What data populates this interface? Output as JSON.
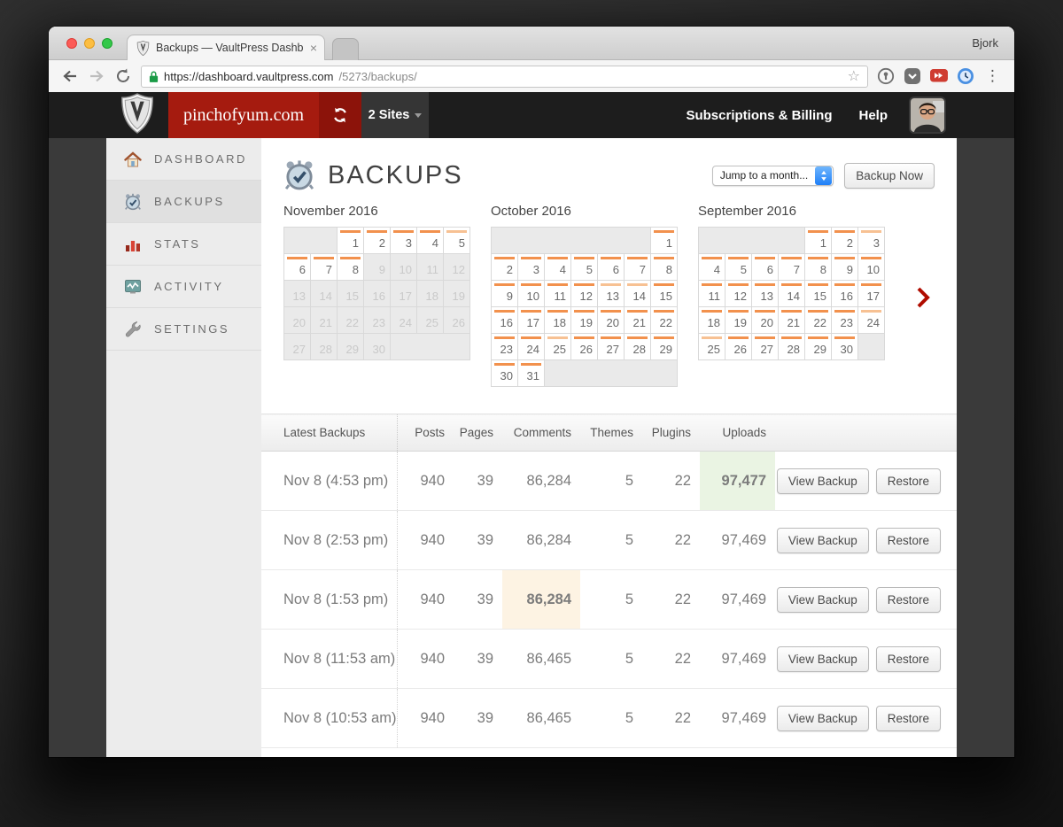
{
  "browser": {
    "profile_name": "Bjork",
    "tab_title": "Backups — VaultPress Dashbo",
    "tab_close": "×",
    "url_host": "https://dashboard.vaultpress.com",
    "url_path": "/5273/backups/"
  },
  "topbar": {
    "site_name": "pinchofyum.com",
    "sites_label": "2 Sites",
    "links": {
      "billing": "Subscriptions & Billing",
      "help": "Help"
    }
  },
  "sidebar": {
    "items": [
      {
        "label": "DASHBOARD",
        "icon": "house-icon",
        "selected": false
      },
      {
        "label": "BACKUPS",
        "icon": "alarm-clock-icon",
        "selected": true
      },
      {
        "label": "STATS",
        "icon": "bar-chart-icon",
        "selected": false
      },
      {
        "label": "ACTIVITY",
        "icon": "activity-monitor-icon",
        "selected": false
      },
      {
        "label": "SETTINGS",
        "icon": "wrench-icon",
        "selected": false
      }
    ]
  },
  "main": {
    "title": "BACKUPS",
    "month_select_value": "Jump to a month...",
    "backup_now_label": "Backup Now",
    "calendars": [
      {
        "title": "November 2016",
        "weeks": [
          [
            {
              "span": 2
            },
            {
              "d": "1",
              "bar": "full"
            },
            {
              "d": "2",
              "bar": "full"
            },
            {
              "d": "3",
              "bar": "full"
            },
            {
              "d": "4",
              "bar": "full"
            },
            {
              "d": "5",
              "bar": "light"
            }
          ],
          [
            {
              "d": "6",
              "bar": "full"
            },
            {
              "d": "7",
              "bar": "full"
            },
            {
              "d": "8",
              "bar": "full"
            },
            {
              "d": "9",
              "off": true
            },
            {
              "d": "10",
              "off": true
            },
            {
              "d": "11",
              "off": true
            },
            {
              "d": "12",
              "off": true
            }
          ],
          [
            {
              "d": "13",
              "off": true
            },
            {
              "d": "14",
              "off": true
            },
            {
              "d": "15",
              "off": true
            },
            {
              "d": "16",
              "off": true
            },
            {
              "d": "17",
              "off": true
            },
            {
              "d": "18",
              "off": true
            },
            {
              "d": "19",
              "off": true
            }
          ],
          [
            {
              "d": "20",
              "off": true
            },
            {
              "d": "21",
              "off": true
            },
            {
              "d": "22",
              "off": true
            },
            {
              "d": "23",
              "off": true
            },
            {
              "d": "24",
              "off": true
            },
            {
              "d": "25",
              "off": true
            },
            {
              "d": "26",
              "off": true
            }
          ],
          [
            {
              "d": "27",
              "off": true
            },
            {
              "d": "28",
              "off": true
            },
            {
              "d": "29",
              "off": true
            },
            {
              "d": "30",
              "off": true
            },
            {
              "span": 3
            }
          ]
        ]
      },
      {
        "title": "October 2016",
        "weeks": [
          [
            {
              "span": 6
            },
            {
              "d": "1",
              "bar": "full"
            }
          ],
          [
            {
              "d": "2",
              "bar": "full"
            },
            {
              "d": "3",
              "bar": "full"
            },
            {
              "d": "4",
              "bar": "full"
            },
            {
              "d": "5",
              "bar": "full"
            },
            {
              "d": "6",
              "bar": "full"
            },
            {
              "d": "7",
              "bar": "full"
            },
            {
              "d": "8",
              "bar": "full"
            }
          ],
          [
            {
              "d": "9",
              "bar": "full"
            },
            {
              "d": "10",
              "bar": "full"
            },
            {
              "d": "11",
              "bar": "full"
            },
            {
              "d": "12",
              "bar": "full"
            },
            {
              "d": "13",
              "bar": "light"
            },
            {
              "d": "14",
              "bar": "light"
            },
            {
              "d": "15",
              "bar": "full"
            }
          ],
          [
            {
              "d": "16",
              "bar": "full"
            },
            {
              "d": "17",
              "bar": "full"
            },
            {
              "d": "18",
              "bar": "full"
            },
            {
              "d": "19",
              "bar": "full"
            },
            {
              "d": "20",
              "bar": "full"
            },
            {
              "d": "21",
              "bar": "full"
            },
            {
              "d": "22",
              "bar": "full"
            }
          ],
          [
            {
              "d": "23",
              "bar": "full"
            },
            {
              "d": "24",
              "bar": "full"
            },
            {
              "d": "25",
              "bar": "light"
            },
            {
              "d": "26",
              "bar": "full"
            },
            {
              "d": "27",
              "bar": "full"
            },
            {
              "d": "28",
              "bar": "full"
            },
            {
              "d": "29",
              "bar": "full"
            }
          ],
          [
            {
              "d": "30",
              "bar": "full"
            },
            {
              "d": "31",
              "bar": "full"
            },
            {
              "span": 5
            }
          ]
        ]
      },
      {
        "title": "September 2016",
        "weeks": [
          [
            {
              "span": 4
            },
            {
              "d": "1",
              "bar": "full"
            },
            {
              "d": "2",
              "bar": "full"
            },
            {
              "d": "3",
              "bar": "light"
            }
          ],
          [
            {
              "d": "4",
              "bar": "full"
            },
            {
              "d": "5",
              "bar": "full"
            },
            {
              "d": "6",
              "bar": "full"
            },
            {
              "d": "7",
              "bar": "full"
            },
            {
              "d": "8",
              "bar": "full"
            },
            {
              "d": "9",
              "bar": "full"
            },
            {
              "d": "10",
              "bar": "full"
            }
          ],
          [
            {
              "d": "11",
              "bar": "full"
            },
            {
              "d": "12",
              "bar": "full"
            },
            {
              "d": "13",
              "bar": "full"
            },
            {
              "d": "14",
              "bar": "full"
            },
            {
              "d": "15",
              "bar": "full"
            },
            {
              "d": "16",
              "bar": "full"
            },
            {
              "d": "17",
              "bar": "full"
            }
          ],
          [
            {
              "d": "18",
              "bar": "full"
            },
            {
              "d": "19",
              "bar": "full"
            },
            {
              "d": "20",
              "bar": "full"
            },
            {
              "d": "21",
              "bar": "full"
            },
            {
              "d": "22",
              "bar": "full"
            },
            {
              "d": "23",
              "bar": "full"
            },
            {
              "d": "24",
              "bar": "light"
            }
          ],
          [
            {
              "d": "25",
              "bar": "light"
            },
            {
              "d": "26",
              "bar": "full"
            },
            {
              "d": "27",
              "bar": "full"
            },
            {
              "d": "28",
              "bar": "full"
            },
            {
              "d": "29",
              "bar": "full"
            },
            {
              "d": "30",
              "bar": "full"
            },
            {
              "span": 1
            }
          ]
        ]
      }
    ],
    "table": {
      "first_header": "Latest Backups",
      "columns": [
        "Posts",
        "Pages",
        "Comments",
        "Themes",
        "Plugins",
        "Uploads"
      ],
      "action_labels": [
        "View Backup",
        "Restore"
      ],
      "rows": [
        {
          "date": "Nov 8 (4:53 pm)",
          "posts": "940",
          "pages": "39",
          "comments": "86,284",
          "themes": "5",
          "plugins": "22",
          "uploads": "97,477",
          "highlight": {
            "col": "uploads",
            "type": "green"
          }
        },
        {
          "date": "Nov 8 (2:53 pm)",
          "posts": "940",
          "pages": "39",
          "comments": "86,284",
          "themes": "5",
          "plugins": "22",
          "uploads": "97,469"
        },
        {
          "date": "Nov 8 (1:53 pm)",
          "posts": "940",
          "pages": "39",
          "comments": "86,284",
          "themes": "5",
          "plugins": "22",
          "uploads": "97,469",
          "highlight": {
            "col": "comments",
            "type": "orange"
          }
        },
        {
          "date": "Nov 8 (11:53 am)",
          "posts": "940",
          "pages": "39",
          "comments": "86,465",
          "themes": "5",
          "plugins": "22",
          "uploads": "97,469"
        },
        {
          "date": "Nov 8 (10:53 am)",
          "posts": "940",
          "pages": "39",
          "comments": "86,465",
          "themes": "5",
          "plugins": "22",
          "uploads": "97,469"
        }
      ]
    }
  },
  "colors": {
    "brand_red": "#a51b0f",
    "brand_red_dark": "#8c130a",
    "calendar_bar_orange": "#f2914d",
    "calendar_bar_orange_light": "#f7c193",
    "uploads_green_text": "#3e9c36",
    "uploads_green_bg": "#eaf4e3",
    "comments_orange_text": "#e78b24",
    "comments_orange_bg": "#fdf3e3"
  }
}
